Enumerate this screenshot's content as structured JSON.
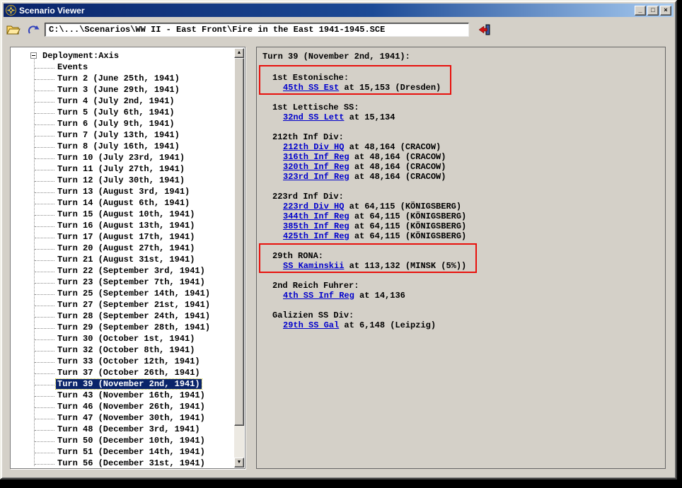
{
  "colors": {
    "selection": "#0a246a",
    "link": "#0000cc",
    "highlight": "#e8100c",
    "titlebar_left": "#0a246a",
    "titlebar_right": "#a6caf0"
  },
  "window": {
    "title": "Scenario Viewer",
    "controls": {
      "minimize": "_",
      "maximize": "□",
      "close": "×"
    }
  },
  "toolbar": {
    "path": "C:\\...\\Scenarios\\WW II - East Front\\Fire in the East 1941-1945.SCE"
  },
  "icons": {
    "scroll_up": "▲",
    "scroll_down": "▼"
  },
  "tree": {
    "root": "Deployment:Axis",
    "items": [
      {
        "label": "Events"
      },
      {
        "label": "Turn 2 (June 25th, 1941)"
      },
      {
        "label": "Turn 3 (June 29th, 1941)"
      },
      {
        "label": "Turn 4 (July 2nd, 1941)"
      },
      {
        "label": "Turn 5 (July 6th, 1941)"
      },
      {
        "label": "Turn 6 (July 9th, 1941)"
      },
      {
        "label": "Turn 7 (July 13th, 1941)"
      },
      {
        "label": "Turn 8 (July 16th, 1941)"
      },
      {
        "label": "Turn 10 (July 23rd, 1941)"
      },
      {
        "label": "Turn 11 (July 27th, 1941)"
      },
      {
        "label": "Turn 12 (July 30th, 1941)"
      },
      {
        "label": "Turn 13 (August 3rd, 1941)"
      },
      {
        "label": "Turn 14 (August 6th, 1941)"
      },
      {
        "label": "Turn 15 (August 10th, 1941)"
      },
      {
        "label": "Turn 16 (August 13th, 1941)"
      },
      {
        "label": "Turn 17 (August 17th, 1941)"
      },
      {
        "label": "Turn 20 (August 27th, 1941)"
      },
      {
        "label": "Turn 21 (August 31st, 1941)"
      },
      {
        "label": "Turn 22 (September 3rd, 1941)"
      },
      {
        "label": "Turn 23 (September 7th, 1941)"
      },
      {
        "label": "Turn 25 (September 14th, 1941)"
      },
      {
        "label": "Turn 27 (September 21st, 1941)"
      },
      {
        "label": "Turn 28 (September 24th, 1941)"
      },
      {
        "label": "Turn 29 (September 28th, 1941)"
      },
      {
        "label": "Turn 30 (October 1st, 1941)"
      },
      {
        "label": "Turn 32 (October 8th, 1941)"
      },
      {
        "label": "Turn 33 (October 12th, 1941)"
      },
      {
        "label": "Turn 37 (October 26th, 1941)"
      },
      {
        "label": "Turn 39 (November 2nd, 1941)",
        "selected": true
      },
      {
        "label": "Turn 43 (November 16th, 1941)"
      },
      {
        "label": "Turn 46 (November 26th, 1941)"
      },
      {
        "label": "Turn 47 (November 30th, 1941)"
      },
      {
        "label": "Turn 48 (December 3rd, 1941)"
      },
      {
        "label": "Turn 50 (December 10th, 1941)"
      },
      {
        "label": "Turn 51 (December 14th, 1941)"
      },
      {
        "label": "Turn 56 (December 31st, 1941)"
      }
    ]
  },
  "detail": {
    "header": "Turn 39 (November 2nd, 1941):",
    "groups": [
      {
        "title": "1st Estonische:",
        "highlighted": true,
        "units": [
          {
            "name": "45th SS Est",
            "rest": " at 15,153 (Dresden)"
          }
        ]
      },
      {
        "title": "1st Lettische SS:",
        "units": [
          {
            "name": "32nd SS Lett",
            "rest": " at 15,134"
          }
        ]
      },
      {
        "title": "212th Inf Div:",
        "units": [
          {
            "name": "212th Div HQ",
            "rest": " at 48,164 (CRACOW)"
          },
          {
            "name": "316th Inf Reg",
            "rest": " at 48,164 (CRACOW)"
          },
          {
            "name": "320th Inf Reg",
            "rest": " at 48,164 (CRACOW)"
          },
          {
            "name": "323rd Inf Reg",
            "rest": " at 48,164 (CRACOW)"
          }
        ]
      },
      {
        "title": "223rd Inf Div:",
        "units": [
          {
            "name": "223rd Div HQ",
            "rest": " at 64,115 (KÖNIGSBERG)"
          },
          {
            "name": "344th Inf Reg",
            "rest": " at 64,115 (KÖNIGSBERG)"
          },
          {
            "name": "385th Inf Reg",
            "rest": " at 64,115 (KÖNIGSBERG)"
          },
          {
            "name": "425th Inf Reg",
            "rest": " at 64,115 (KÖNIGSBERG)"
          }
        ]
      },
      {
        "title": "29th RONA:",
        "highlighted": true,
        "units": [
          {
            "name": "SS Kaminskii",
            "rest": " at 113,132 (MINSK (5%))"
          }
        ]
      },
      {
        "title": "2nd Reich Fuhrer:",
        "units": [
          {
            "name": "4th SS Inf Reg",
            "rest": " at 14,136"
          }
        ]
      },
      {
        "title": "Galizien SS Div:",
        "units": [
          {
            "name": "29th SS Gal",
            "rest": " at 6,148 (Leipzig)"
          }
        ]
      }
    ]
  }
}
